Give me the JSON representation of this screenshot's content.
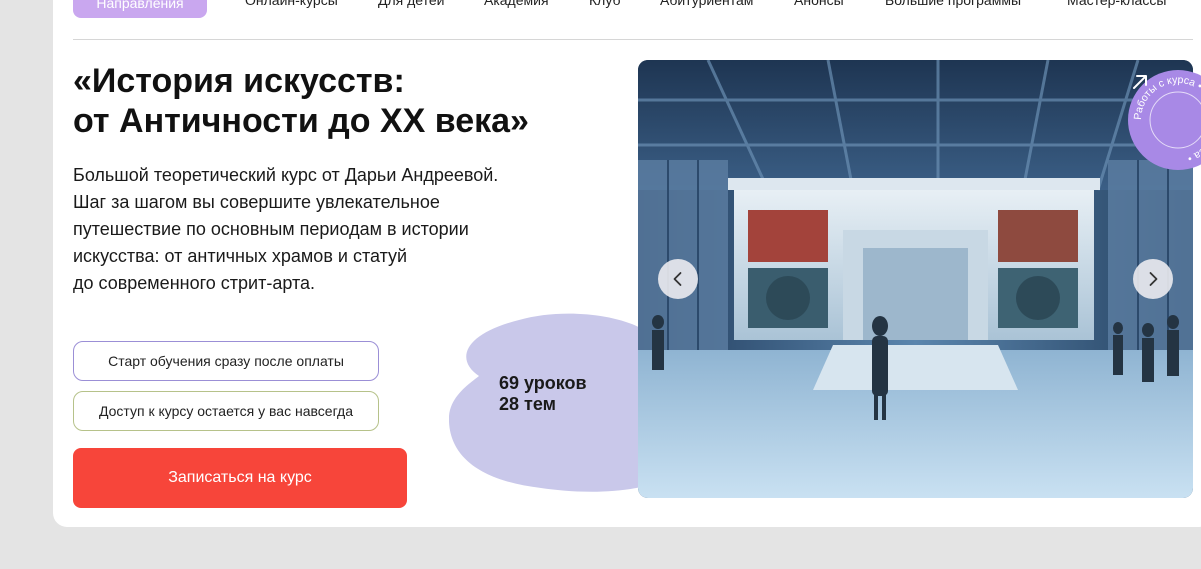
{
  "nav": {
    "primary_label": "Направления",
    "links": [
      "Онлайн-курсы",
      "Для детей",
      "Академия",
      "Клуб",
      "Абитуриентам",
      "Анонсы",
      "Большие программы",
      "Мастер-классы"
    ]
  },
  "course": {
    "title_line1": "«История искусств:",
    "title_line2": "от Античности до XX века»",
    "description_lines": [
      "Большой теоретический курс от Дарьи Андреевой.",
      "Шаг за шагом вы совершите увлекательное",
      "путешествие по основным периодам в истории",
      "искусства: от античных храмов и статуй",
      "до современного стрит-арта."
    ]
  },
  "features": {
    "start": "Старт обучения сразу после оплаты",
    "access": "Доступ к курсу остается у вас навсегда"
  },
  "cta_label": "Записаться на курс",
  "stats": {
    "lessons": "69 уроков",
    "topics": "28 тем"
  },
  "badge_text": "Работы с курса • Работы с курса •",
  "colors": {
    "accent": "#f7453a",
    "pill": "#c9a7ef",
    "blob": "#c9c8ea",
    "badge": "#a889e6"
  },
  "icons": {
    "prev": "chevron-left-icon",
    "next": "chevron-right-icon",
    "badge": "arrow-up-right-icon"
  }
}
